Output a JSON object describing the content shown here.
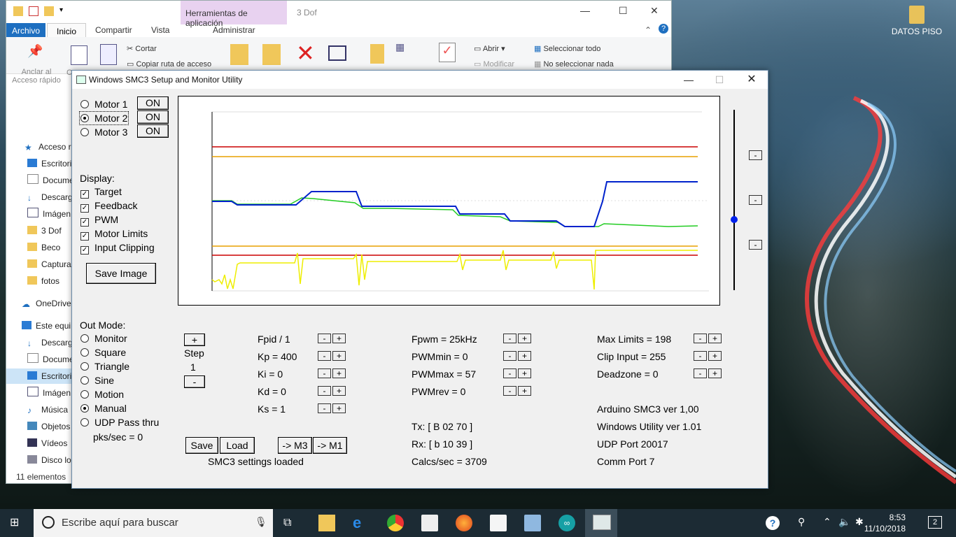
{
  "desktop": {
    "icon_label": "DATOS PISO"
  },
  "explorer": {
    "tools_tab": "Herramientas de aplicación",
    "caption": "3 Dof",
    "tabs": [
      "Archivo",
      "Inicio",
      "Compartir",
      "Vista",
      "Administrar"
    ],
    "ribbon": {
      "pin_label": "Anclar al",
      "pin_label2": "Acceso rápido",
      "copy_label": "C",
      "cut": "Cortar",
      "copy_path": "Copiar ruta de acceso",
      "open": "Abrir",
      "modify": "Modificar",
      "select_all": "Seleccionar todo",
      "select_none": "No seleccionar nada"
    },
    "nav": [
      "Acceso rá",
      "Escritori",
      "Docume",
      "Descarg",
      "Imágen",
      "3 Dof",
      "Beco",
      "Captura",
      "fotos",
      "OneDrive",
      "Este equi",
      "Descarg",
      "Docume",
      "Escritori",
      "Imágen",
      "Música",
      "Objetos",
      "Vídeos",
      "Disco lo"
    ],
    "status": "11 elementos"
  },
  "smc": {
    "title": "Windows SMC3 Setup and Monitor Utility",
    "motors": [
      {
        "label": "Motor 1",
        "state": "ON",
        "selected": false
      },
      {
        "label": "Motor 2",
        "state": "ON",
        "selected": true
      },
      {
        "label": "Motor 3",
        "state": "ON",
        "selected": false
      }
    ],
    "display_label": "Display:",
    "display": [
      "Target",
      "Feedback",
      "PWM",
      "Motor Limits",
      "Input Clipping"
    ],
    "save_image": "Save Image",
    "out_mode_label": "Out Mode:",
    "out_modes": [
      "Monitor",
      "Square",
      "Triangle",
      "Sine",
      "Motion",
      "Manual",
      "UDP Pass thru"
    ],
    "selected_mode": "Manual",
    "pks": "pks/sec = 0",
    "step": {
      "plus": "+",
      "label": "Step",
      "value": "1",
      "minus": "-"
    },
    "pid": [
      "Fpid / 1",
      "Kp = 400",
      "Ki = 0",
      "Kd = 0",
      "Ks = 1"
    ],
    "pwm": [
      "Fpwm = 25kHz",
      "PWMmin = 0",
      "PWMmax = 57",
      "PWMrev = 0"
    ],
    "limits": [
      "Max Limits = 198",
      "Clip Input = 255",
      "Deadzone = 0"
    ],
    "info": [
      "Arduino SMC3 ver 1,00",
      "Windows Utility ver 1.01",
      "UDP Port 20017",
      "Comm Port 7"
    ],
    "tx": "Tx: [ B 02 70 ]",
    "rx": "Rx: [ b 10 39 ]",
    "calcs": "Calcs/sec = 3709",
    "buttons": {
      "save": "Save",
      "load": "Load",
      "m3": "-> M3",
      "m1": "-> M1",
      "minus": "-",
      "plus": "+"
    },
    "settings_status": "SMC3 settings loaded",
    "slider_level": 0.39
  },
  "taskbar": {
    "search_placeholder": "Escribe aquí para buscar",
    "time": "8:53",
    "date": "11/10/2018",
    "notifications": "2"
  },
  "colors": {
    "target": "#0022cc",
    "feedback": "#22cc22",
    "pwm": "#eeee00",
    "limits": "#cc0000",
    "clip": "#e8a000"
  }
}
